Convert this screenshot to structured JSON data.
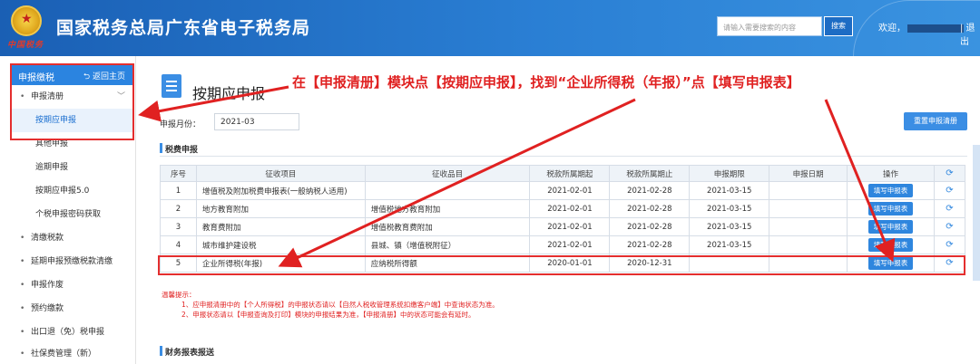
{
  "header": {
    "site_title": "国家税务总局广东省电子税务局",
    "logo_text": "中国税务",
    "search_placeholder": "请输入需要搜索的内容",
    "search_button": "搜索",
    "welcome": "欢迎，",
    "logout": "| 退出"
  },
  "sidebar": {
    "head_title": "申报缴税",
    "back_label": "返回主页",
    "items": [
      {
        "label": "申报清册",
        "type": "group",
        "expanded": true
      },
      {
        "label": "按期应申报",
        "type": "sub",
        "active": true
      },
      {
        "label": "其他申报",
        "type": "sub"
      },
      {
        "label": "逾期申报",
        "type": "sub"
      },
      {
        "label": "按期应申报5.0",
        "type": "sub"
      },
      {
        "label": "个税申报密码获取",
        "type": "sub"
      },
      {
        "label": "清缴税款",
        "type": "group"
      },
      {
        "label": "延期申报预缴税款清缴",
        "type": "group"
      },
      {
        "label": "申报作废",
        "type": "group"
      },
      {
        "label": "预约缴款",
        "type": "group"
      },
      {
        "label": "出口退（免）税申报",
        "type": "group"
      },
      {
        "label": "社保费管理（新）",
        "type": "group"
      }
    ]
  },
  "main": {
    "page_title": "按期应申报",
    "annotation": "在【申报清册】模块点【按期应申报】，找到“企业所得税（年报）”点【填写申报表】",
    "month_label": "申报月份：",
    "month_value": "2021-03",
    "reset_button": "重置申报清册",
    "section_title": "税费申报",
    "section_title2": "财务报表报送",
    "table": {
      "headers": [
        "序号",
        "征收项目",
        "征收品目",
        "税款所属期起",
        "税款所属期止",
        "申报期限",
        "申报日期",
        "操作",
        "⟳"
      ],
      "rows": [
        [
          "1",
          "增值税及附加税费申报表(一般纳税人适用)",
          "",
          "2021-02-01",
          "2021-02-28",
          "2021-03-15",
          "",
          "填写申报表",
          "⟳"
        ],
        [
          "2",
          "地方教育附加",
          "增值税地方教育附加",
          "2021-02-01",
          "2021-02-28",
          "2021-03-15",
          "",
          "填写申报表",
          "⟳"
        ],
        [
          "3",
          "教育费附加",
          "增值税教育费附加",
          "2021-02-01",
          "2021-02-28",
          "2021-03-15",
          "",
          "填写申报表",
          "⟳"
        ],
        [
          "4",
          "城市维护建设税",
          "县城、镇（增值税附征）",
          "2021-02-01",
          "2021-02-28",
          "2021-03-15",
          "",
          "填写申报表",
          "⟳"
        ],
        [
          "5",
          "企业所得税(年报)",
          "应纳税所得额",
          "2020-01-01",
          "2020-12-31",
          "",
          "",
          "填写申报表",
          "⟳"
        ]
      ]
    },
    "tips": {
      "title": "温馨提示：",
      "line1": "1、应申报清册中的【个人所得税】的申报状态请以【自然人税收管理系统扣缴客户端】中查询状态为准。",
      "line2": "2、申报状态请以【申报查询及打印】模块的申报结果为准，【申报清册】中的状态可能会有延时。"
    }
  },
  "colors": {
    "brand_blue": "#2b84e0",
    "annotation_red": "#e02121"
  }
}
